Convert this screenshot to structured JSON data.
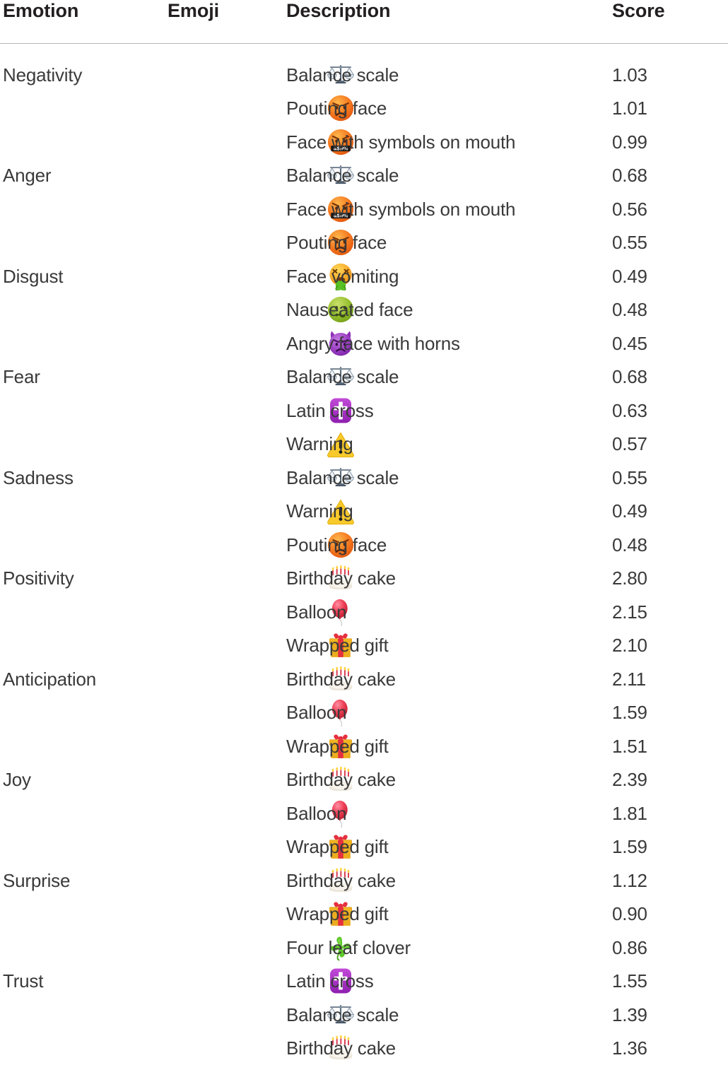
{
  "table": {
    "columns": [
      {
        "key": "emotion",
        "label": "Emotion"
      },
      {
        "key": "emoji",
        "label": "Emoji"
      },
      {
        "key": "description",
        "label": "Description"
      },
      {
        "key": "score",
        "label": "Score"
      }
    ],
    "rows": [
      {
        "emotion": "Negativity",
        "emoji": "balance-scale",
        "description": "Balance scale",
        "score": "1.03"
      },
      {
        "emotion": "",
        "emoji": "pouting-face",
        "description": "Pouting face",
        "score": "1.01"
      },
      {
        "emotion": "",
        "emoji": "face-with-symbols-on-mouth",
        "description": "Face with symbols on mouth",
        "score": "0.99"
      },
      {
        "emotion": "Anger",
        "emoji": "balance-scale",
        "description": "Balance scale",
        "score": "0.68"
      },
      {
        "emotion": "",
        "emoji": "face-with-symbols-on-mouth",
        "description": "Face with symbols on mouth",
        "score": "0.56"
      },
      {
        "emotion": "",
        "emoji": "pouting-face",
        "description": "Pouting face",
        "score": "0.55"
      },
      {
        "emotion": "Disgust",
        "emoji": "face-vomiting",
        "description": "Face vomiting",
        "score": "0.49"
      },
      {
        "emotion": "",
        "emoji": "nauseated-face",
        "description": "Nauseated face",
        "score": "0.48"
      },
      {
        "emotion": "",
        "emoji": "angry-face-with-horns",
        "description": "Angry face with horns",
        "score": "0.45"
      },
      {
        "emotion": "Fear",
        "emoji": "balance-scale",
        "description": "Balance scale",
        "score": "0.68"
      },
      {
        "emotion": "",
        "emoji": "latin-cross",
        "description": "Latin cross",
        "score": "0.63"
      },
      {
        "emotion": "",
        "emoji": "warning",
        "description": "Warning",
        "score": "0.57"
      },
      {
        "emotion": "Sadness",
        "emoji": "balance-scale",
        "description": "Balance scale",
        "score": "0.55"
      },
      {
        "emotion": "",
        "emoji": "warning",
        "description": "Warning",
        "score": "0.49"
      },
      {
        "emotion": "",
        "emoji": "pouting-face",
        "description": "Pouting face",
        "score": "0.48"
      },
      {
        "emotion": "Positivity",
        "emoji": "birthday-cake",
        "description": "Birthday cake",
        "score": "2.80"
      },
      {
        "emotion": "",
        "emoji": "balloon",
        "description": "Balloon",
        "score": "2.15"
      },
      {
        "emotion": "",
        "emoji": "wrapped-gift",
        "description": "Wrapped gift",
        "score": "2.10"
      },
      {
        "emotion": "Anticipation",
        "emoji": "birthday-cake",
        "description": "Birthday cake",
        "score": "2.11"
      },
      {
        "emotion": "",
        "emoji": "balloon",
        "description": "Balloon",
        "score": "1.59"
      },
      {
        "emotion": "",
        "emoji": "wrapped-gift",
        "description": "Wrapped gift",
        "score": "1.51"
      },
      {
        "emotion": "Joy",
        "emoji": "birthday-cake",
        "description": "Birthday cake",
        "score": "2.39"
      },
      {
        "emotion": "",
        "emoji": "balloon",
        "description": "Balloon",
        "score": "1.81"
      },
      {
        "emotion": "",
        "emoji": "wrapped-gift",
        "description": "Wrapped gift",
        "score": "1.59"
      },
      {
        "emotion": "Surprise",
        "emoji": "birthday-cake",
        "description": "Birthday cake",
        "score": "1.12"
      },
      {
        "emotion": "",
        "emoji": "wrapped-gift",
        "description": "Wrapped gift",
        "score": "0.90"
      },
      {
        "emotion": "",
        "emoji": "four-leaf-clover",
        "description": "Four leaf clover",
        "score": "0.86"
      },
      {
        "emotion": "Trust",
        "emoji": "latin-cross",
        "description": "Latin cross",
        "score": "1.55"
      },
      {
        "emotion": "",
        "emoji": "balance-scale",
        "description": "Balance scale",
        "score": "1.39"
      },
      {
        "emotion": "",
        "emoji": "birthday-cake",
        "description": "Birthday cake",
        "score": "1.36"
      }
    ]
  },
  "colors": {
    "text": "#3a3a3a",
    "header_text": "#231f20",
    "rule": "#b5b5b5",
    "background": "#ffffff"
  }
}
